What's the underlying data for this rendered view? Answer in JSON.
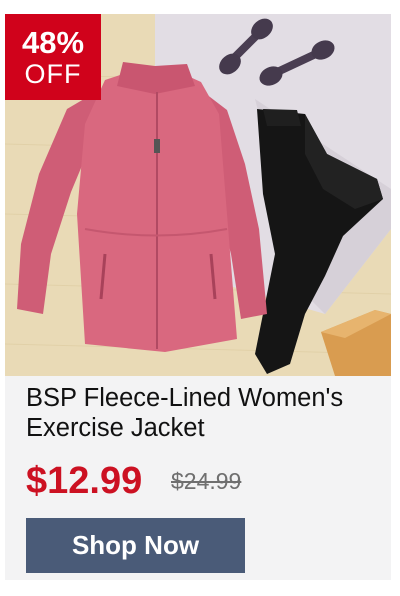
{
  "badge": {
    "percent": "48%",
    "off": "OFF"
  },
  "product": {
    "title": "BSP Fleece-Lined Women's Exercise Jacket",
    "price": "$12.99",
    "original_price": "$24.99"
  },
  "cta": {
    "label": "Shop Now"
  },
  "colors": {
    "badge": "#d0021b",
    "price": "#cc1122",
    "button": "#4a5b78",
    "jacket": "#d9687f",
    "leggings": "#141414"
  }
}
